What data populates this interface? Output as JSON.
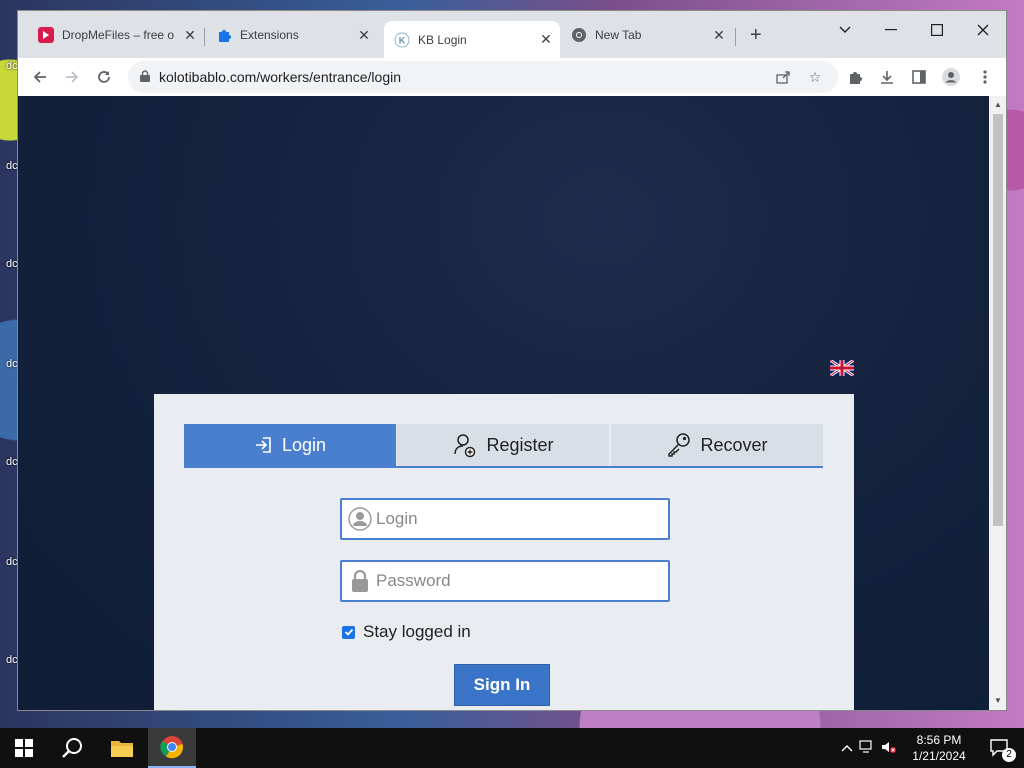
{
  "desktop": {
    "icon_label_fragments": [
      "dc",
      "C"
    ]
  },
  "browser": {
    "tabs": [
      {
        "title": "DropMeFiles – free o",
        "favicon": "dropmefiles-icon",
        "active": false
      },
      {
        "title": "Extensions",
        "favicon": "puzzle-icon",
        "active": false
      },
      {
        "title": "KB Login",
        "favicon": "kb-icon",
        "favicon_letter": "K",
        "active": true
      },
      {
        "title": "New Tab",
        "favicon": "chrome-icon",
        "active": false
      }
    ],
    "new_tab": "+",
    "url": "kolotibablo.com/workers/entrance/login",
    "window_controls": [
      "chevron-down-icon",
      "minimize-icon",
      "maximize-icon",
      "close-icon"
    ]
  },
  "page": {
    "language_flag": "uk-flag",
    "tabs": [
      {
        "label": "Login",
        "icon": "login-icon",
        "active": true
      },
      {
        "label": "Register",
        "icon": "register-icon",
        "active": false
      },
      {
        "label": "Recover",
        "icon": "key-icon",
        "active": false
      }
    ],
    "login_field": {
      "placeholder": "Login",
      "value": ""
    },
    "password_field": {
      "placeholder": "Password",
      "value": ""
    },
    "stay_logged_in": {
      "label": "Stay logged in",
      "checked": true
    },
    "sign_in_label": "Sign In",
    "accent_color": "#4a7fcf"
  },
  "taskbar": {
    "time": "8:56 PM",
    "date": "1/21/2024",
    "notification_count": "2"
  }
}
